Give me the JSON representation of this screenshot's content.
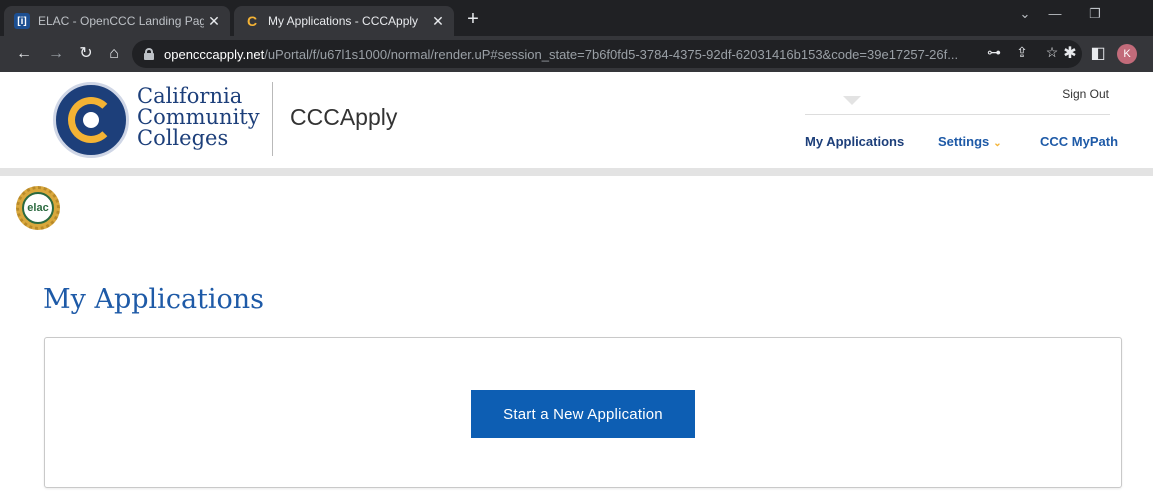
{
  "browser": {
    "tabs": [
      {
        "title": "ELAC - OpenCCC Landing Page",
        "favicon": "[i]"
      },
      {
        "title": "My Applications - CCCApply",
        "favicon": "C"
      }
    ],
    "new_tab": "+",
    "url_domain": "opencccapply.net",
    "url_path": "/uPortal/f/u67l1s1000/normal/render.uP#session_state=7b6f0fd5-3784-4375-92df-62031416b153&code=39e17257-26f...",
    "profile_initial": "K"
  },
  "header": {
    "brand_line1": "California",
    "brand_line2": "Community",
    "brand_line3": "Colleges",
    "app_name": "CCCApply",
    "sign_out": "Sign Out",
    "nav": {
      "my_applications": "My Applications",
      "settings": "Settings",
      "ccc_mypath": "CCC MyPath"
    }
  },
  "college_badge": "elac",
  "main": {
    "title": "My Applications",
    "start_button": "Start a New Application"
  },
  "colors": {
    "brand_blue": "#1d3f7a",
    "link_blue": "#1e5aa7",
    "button_blue": "#0d5eb3",
    "gold": "#f4b334"
  }
}
